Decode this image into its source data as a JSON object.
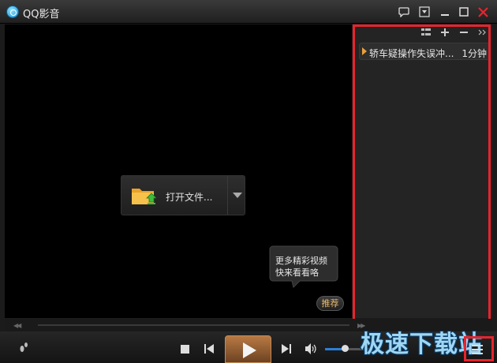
{
  "window": {
    "title": "QQ影音"
  },
  "center": {
    "open_file_label": "打开文件..."
  },
  "promo": {
    "text_line1": "更多精彩视频",
    "text_line2": "快来看看咯",
    "recommend_label": "推荐"
  },
  "playlist": {
    "items": [
      {
        "name": "轿车疑操作失误冲...",
        "duration": "1分钟"
      }
    ]
  },
  "watermark": {
    "text": "极速下载站"
  },
  "colors": {
    "accent": "#2c7ed6",
    "play_button": "#a56a3a",
    "highlight_box": "#e8242c"
  },
  "volume": {
    "level": 0.42
  }
}
